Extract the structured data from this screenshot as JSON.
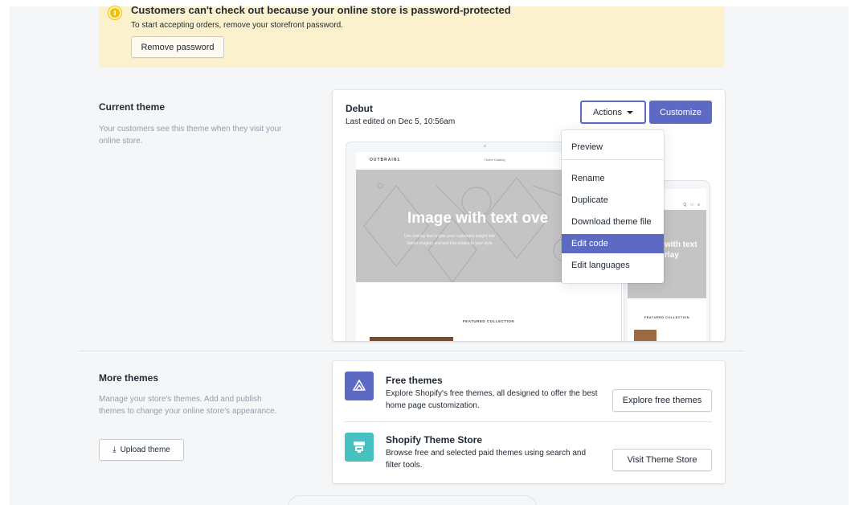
{
  "banner": {
    "title": "Customers can't check out because your online store is password-protected",
    "text": "To start accepting orders, remove your storefront password.",
    "button_label": "Remove password"
  },
  "current_theme": {
    "section_title": "Current theme",
    "section_desc": "Your customers see this theme when they visit your online store.",
    "theme_name": "Debut",
    "last_edited": "Last edited on Dec 5, 10:56am",
    "actions_label": "Actions",
    "customize_label": "Customize",
    "preview": {
      "logo": "OUTBRAIN1",
      "links": "Home   Catalog",
      "hero_title": "Image with text ove",
      "hero_sub_1": "Use overlay text to give your customers insight into",
      "hero_sub_2": "Select imagery and text that relates to your style",
      "featured": "FEATURED COLLECTION",
      "mobile_icons": "Q □ ≡",
      "mobile_hero_1": "with text",
      "mobile_hero_2": "rlay",
      "mobile_featured": "FEATURED COLLECTION"
    }
  },
  "actions_menu": {
    "items": [
      {
        "label": "Preview"
      },
      {
        "label": "Rename"
      },
      {
        "label": "Duplicate"
      },
      {
        "label": "Download theme file"
      },
      {
        "label": "Edit code",
        "active": true
      },
      {
        "label": "Edit languages"
      }
    ]
  },
  "more_themes": {
    "section_title": "More themes",
    "section_desc": "Manage your store's themes. Add and publish themes to change your online store's appearance.",
    "upload_label": "Upload theme",
    "free": {
      "title": "Free themes",
      "desc": "Explore Shopify's free themes, all designed to offer the best home page customization.",
      "button": "Explore free themes",
      "icon": "theme-bag-icon"
    },
    "store": {
      "title": "Shopify Theme Store",
      "desc": "Browse free and selected paid themes using search and filter tools.",
      "button": "Visit Theme Store",
      "icon": "theme-store-icon"
    }
  },
  "colors": {
    "accent": "#5c6ac4",
    "banner_bg": "#fcf1cd",
    "store_tile": "#47c1bf"
  }
}
